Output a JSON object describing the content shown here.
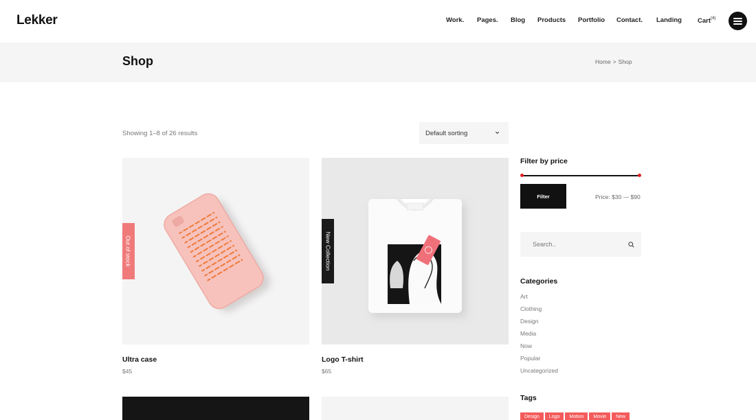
{
  "header": {
    "logo": "Lekker",
    "nav": [
      {
        "label": "Work."
      },
      {
        "label": "Pages."
      },
      {
        "label": "Blog"
      },
      {
        "label": "Products"
      },
      {
        "label": "Portfolio"
      },
      {
        "label": "Contact."
      },
      {
        "label": "Landing"
      }
    ],
    "cart": {
      "label": "Cart",
      "count": "(4)"
    },
    "menu_icon": "hamburger-icon"
  },
  "title_band": {
    "title": "Shop",
    "breadcrumb": {
      "home": "Home",
      "separator": ">",
      "current": "Shop"
    }
  },
  "toolbar": {
    "result_count": "Showing 1–8 of 26 results",
    "sorting": {
      "selected": "Default sorting",
      "icon": "chevron-down-icon"
    }
  },
  "products": [
    {
      "name": "Ultra case",
      "price": "$45",
      "badge": "Out of stock",
      "badge_color": "#f07a7a",
      "image": "phone-case-image"
    },
    {
      "name": "Logo T-shirt",
      "price": "$65",
      "badge": "New Collection",
      "badge_color": "#1a1a1a",
      "image": "tshirt-image"
    }
  ],
  "sidebar": {
    "price_filter": {
      "title": "Filter by price",
      "button": "Filter",
      "range_label": "Price:",
      "min": "$30",
      "dash": "—",
      "max": "$90",
      "handle_color": "#e02020"
    },
    "search": {
      "placeholder": "Search..",
      "icon": "search-icon"
    },
    "categories": {
      "title": "Categories",
      "items": [
        "Art",
        "Clothing",
        "Design",
        "Media",
        "Now",
        "Popular",
        "Uncategorized"
      ]
    },
    "tags": {
      "title": "Tags",
      "items": [
        "Design",
        "Logo",
        "Motion",
        "Movie",
        "New"
      ],
      "color": "#f45b5b"
    }
  },
  "colors": {
    "accent": "#f45b5b",
    "dark": "#111111",
    "band": "#f5f5f5"
  }
}
